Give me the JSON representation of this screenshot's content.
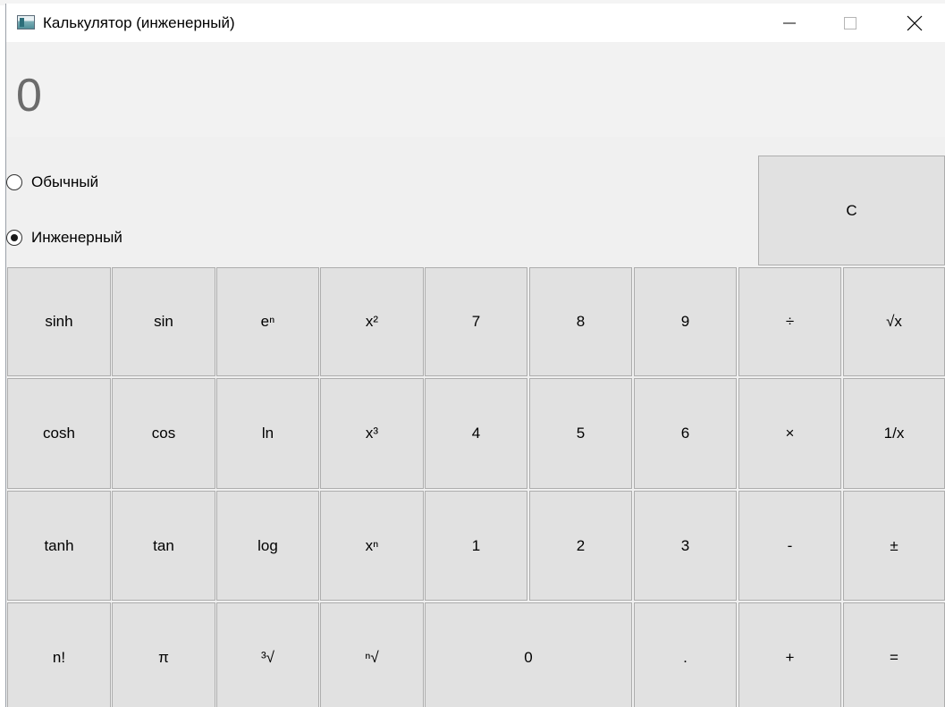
{
  "window": {
    "title": "Калькулятор (инженерный)"
  },
  "display": {
    "value": "0"
  },
  "modes": {
    "basic_label": "Обычный",
    "scientific_label": "Инженерный",
    "selected": "Инженерный"
  },
  "buttons": {
    "clear": "C",
    "sinh": "sinh",
    "sin": "sin",
    "exp": "eⁿ",
    "square": "x²",
    "d7": "7",
    "d8": "8",
    "d9": "9",
    "divide": "÷",
    "sqrt": "√x",
    "cosh": "cosh",
    "cos": "cos",
    "ln": "ln",
    "cube": "x³",
    "d4": "4",
    "d5": "5",
    "d6": "6",
    "multiply": "×",
    "reciprocal": "1/x",
    "tanh": "tanh",
    "tan": "tan",
    "log": "log",
    "power": "xⁿ",
    "d1": "1",
    "d2": "2",
    "d3": "3",
    "minus": "-",
    "negate": "±",
    "factorial": "n!",
    "pi": "π",
    "cbrt": "³√",
    "nroot": "ⁿ√",
    "d0": "0",
    "decimal": ".",
    "plus": "+",
    "equals": "="
  },
  "icons": {
    "app": "calculator-window-icon",
    "minimize": "minimize-icon",
    "maximize": "maximize-icon",
    "close": "close-icon"
  }
}
